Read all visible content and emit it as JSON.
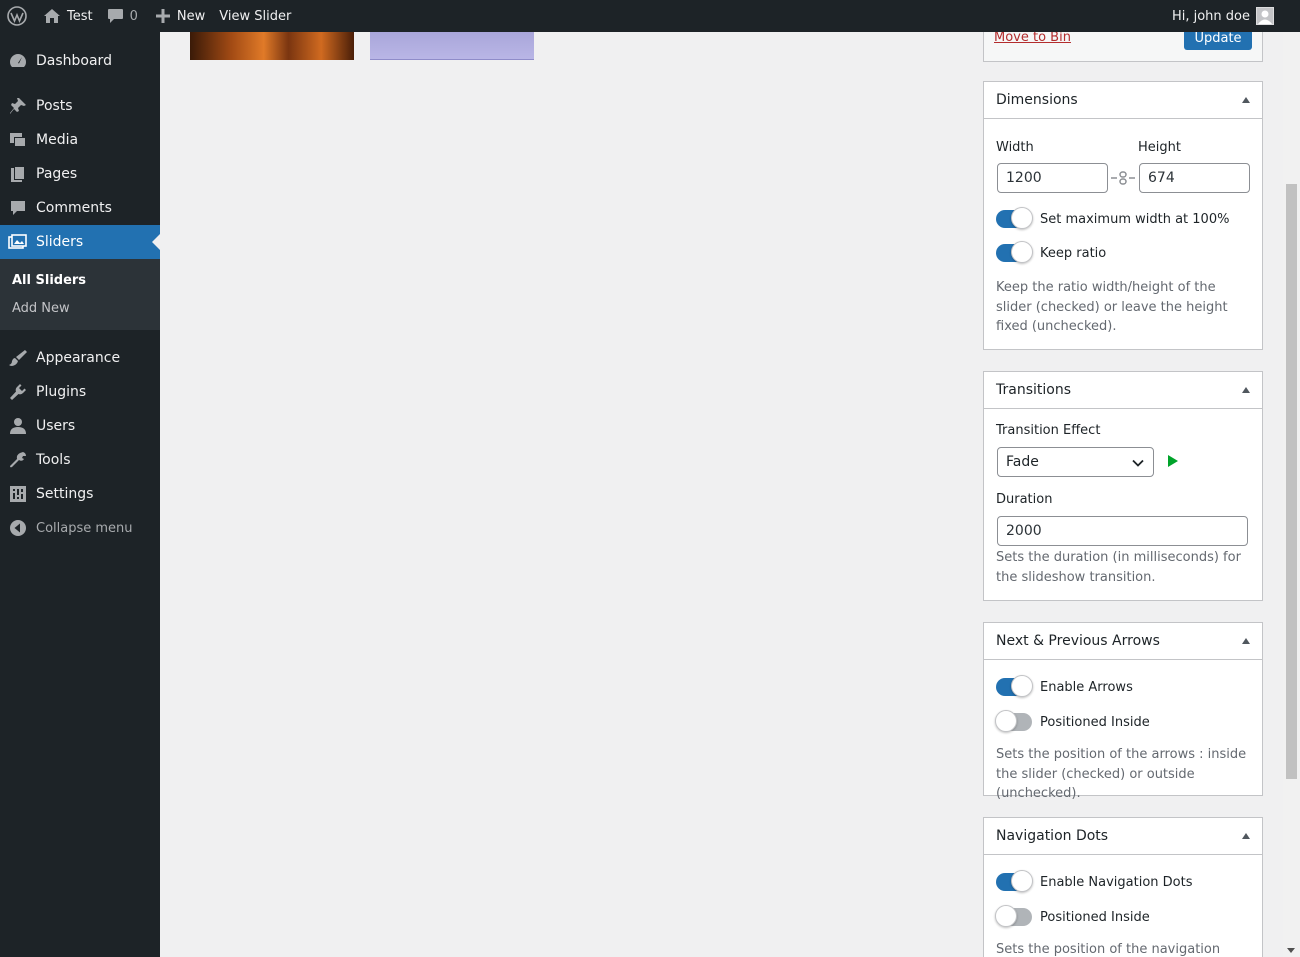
{
  "adminbar": {
    "site_name": "Test",
    "comments_count": "0",
    "new_label": "New",
    "view_label": "View Slider",
    "greeting": "Hi, john doe"
  },
  "sidebar": {
    "items": [
      {
        "label": "Dashboard",
        "icon": "dashboard-icon"
      },
      {
        "label": "Posts",
        "icon": "pushpin-icon"
      },
      {
        "label": "Media",
        "icon": "media-icon"
      },
      {
        "label": "Pages",
        "icon": "pages-icon"
      },
      {
        "label": "Comments",
        "icon": "comments-icon"
      },
      {
        "label": "Sliders",
        "icon": "slider-icon"
      },
      {
        "label": "Appearance",
        "icon": "paintbrush-icon"
      },
      {
        "label": "Plugins",
        "icon": "plugin-icon"
      },
      {
        "label": "Users",
        "icon": "user-icon"
      },
      {
        "label": "Tools",
        "icon": "wrench-icon"
      },
      {
        "label": "Settings",
        "icon": "settings-icon"
      }
    ],
    "submenu": [
      "All Sliders",
      "Add New"
    ],
    "collapse_label": "Collapse menu"
  },
  "publish": {
    "bin_label": "Move to Bin",
    "update_label": "Update"
  },
  "dimensions": {
    "title": "Dimensions",
    "width_label": "Width",
    "height_label": "Height",
    "width_value": "1200",
    "height_value": "674",
    "max_width_label": "Set maximum width at 100%",
    "keep_ratio_label": "Keep ratio",
    "help": "Keep the ratio width/height of the slider (checked) or leave the height fixed (unchecked)."
  },
  "transitions": {
    "title": "Transitions",
    "effect_label": "Transition Effect",
    "effect_value": "Fade",
    "duration_label": "Duration",
    "duration_value": "2000",
    "help": "Sets the duration (in milliseconds) for the slideshow transition."
  },
  "arrows": {
    "title": "Next & Previous Arrows",
    "enable_label": "Enable Arrows",
    "inside_label": "Positioned Inside",
    "help": "Sets the position of the arrows : inside the slider (checked) or outside (unchecked)."
  },
  "dots": {
    "title": "Navigation Dots",
    "enable_label": "Enable Navigation Dots",
    "inside_label": "Positioned Inside",
    "help": "Sets the position of the navigation dots :"
  },
  "colors": {
    "admin_dark": "#1d2327",
    "accent": "#2271b1",
    "play_green": "#00a32a"
  }
}
